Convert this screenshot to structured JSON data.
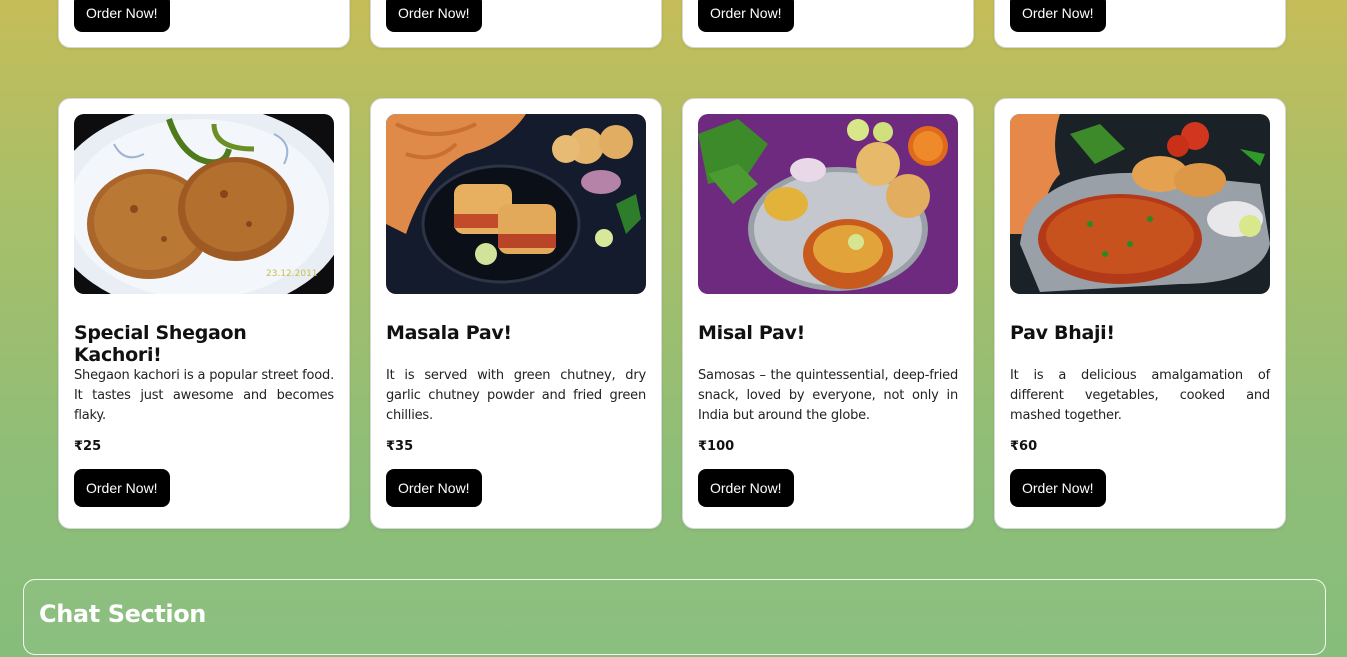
{
  "top_row": {
    "order_label": "Order Now!"
  },
  "menu_items": [
    {
      "title": "Special Shegaon Kachori!",
      "description": "Shegaon kachori is a popular street food. It tastes just awesome and becomes flaky.",
      "price": "₹25",
      "order_label": "Order Now!",
      "image": "kachori-photo"
    },
    {
      "title": "Masala Pav!",
      "description": "It is served with green chutney, dry garlic chutney powder and fried green chillies.",
      "price": "₹35",
      "order_label": "Order Now!",
      "image": "masala-pav-photo"
    },
    {
      "title": "Misal Pav!",
      "description": "Samosas – the quintessential, deep-fried snack, loved by everyone, not only in India but around the globe.",
      "price": "₹100",
      "order_label": "Order Now!",
      "image": "misal-pav-photo"
    },
    {
      "title": "Pav Bhaji!",
      "description": "It is a delicious amalgamation of different vegetables, cooked and mashed together.",
      "price": "₹60",
      "order_label": "Order Now!",
      "image": "pav-bhaji-photo"
    }
  ],
  "chat": {
    "title": "Chat Section"
  }
}
